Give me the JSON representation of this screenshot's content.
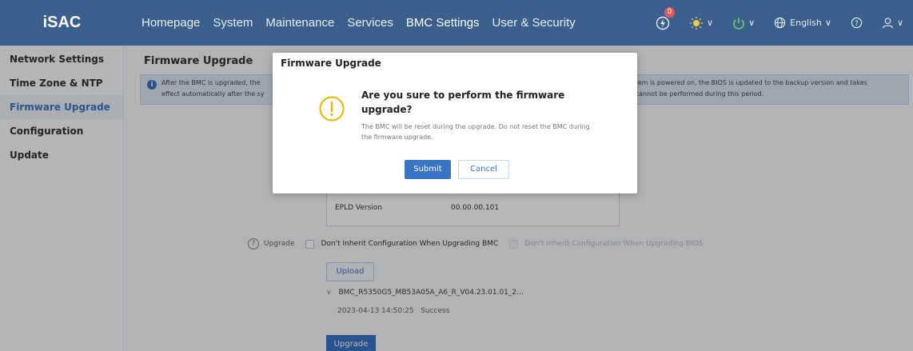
{
  "app": {
    "logo": "iSAC"
  },
  "nav": [
    {
      "label": "Homepage"
    },
    {
      "label": "System"
    },
    {
      "label": "Maintenance"
    },
    {
      "label": "Services"
    },
    {
      "label": "BMC Settings"
    },
    {
      "label": "User & Security"
    }
  ],
  "toolbar": {
    "alarm_count": "0",
    "language": "English",
    "colors": {
      "nav_bg": "#3a5f8c",
      "indicator_yellow": "#f2c94c",
      "power_green": "#6fd36f",
      "accent": "#3a74c4"
    }
  },
  "sidebar": {
    "items": [
      {
        "label": "Network Settings"
      },
      {
        "label": "Time Zone & NTP"
      },
      {
        "label": "Firmware Upgrade"
      },
      {
        "label": "Configuration Update"
      }
    ]
  },
  "page": {
    "title": "Firmware Upgrade",
    "info_left_1": "After the BMC is upgraded, the",
    "info_left_2": "effect automatically after the sy",
    "info_right_1": "e system is powered on, the BIOS is updated to the backup version and takes",
    "info_right_2": "rade cannot be performed during this period."
  },
  "versions": {
    "epld_label": "EPLD Version",
    "epld_value": "00.00.00.101"
  },
  "upgrade": {
    "label": "Upgrade",
    "option_bmc": "Don't Inherit Configuration When Upgrading BMC",
    "option_bios": "Don't Inherit Configuration When Upgrading BIOS",
    "upload_label": "Upload",
    "file_name": "BMC_R5350G5_MB53A05A_A6_R_V04.23.01.01_2...",
    "file_time": "2023-04-13 14:50:25",
    "file_status": "Success",
    "upgrade_button": "Upgrade"
  },
  "dialog": {
    "title": "Firmware Upgrade",
    "heading": "Are you sure to perform the firmware upgrade?",
    "description": "The BMC will be reset during the upgrade. Do not reset the BMC during the firmware upgrade.",
    "submit": "Submit",
    "cancel": "Cancel"
  }
}
